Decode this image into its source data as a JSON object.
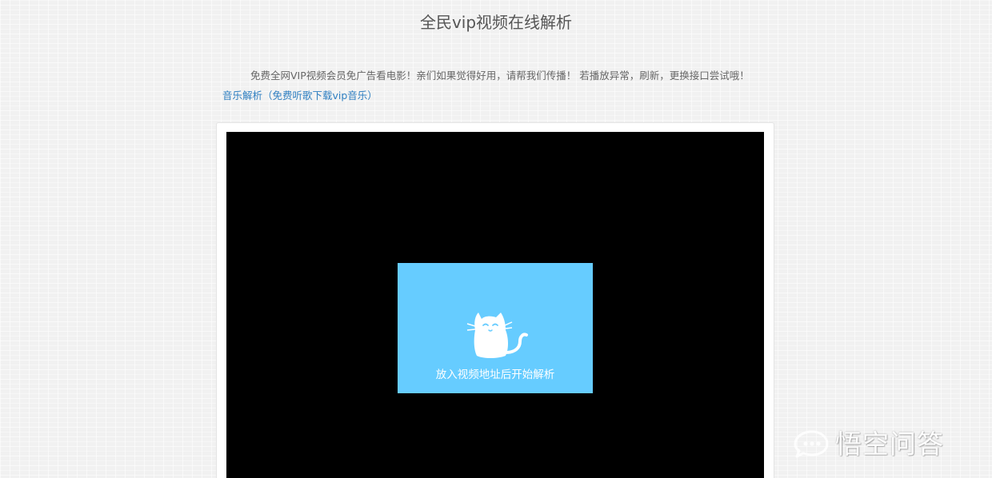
{
  "header": {
    "title": "全民vip视频在线解析"
  },
  "intro": {
    "notice": "免费全网VIP视频会员免广告看电影！亲们如果觉得好用，请帮我们传播！ 若播放异常，刷新，更换接口尝试哦！",
    "music_link": "音乐解析（免费听歌下载vip音乐）"
  },
  "player": {
    "placeholder_text": "放入视频地址后开始解析",
    "icon": "cat-icon",
    "placeholder_color": "#66ccff",
    "background_color": "#000000"
  },
  "watermark": {
    "text": "悟空问答",
    "icon": "speech-bubble-icon"
  }
}
